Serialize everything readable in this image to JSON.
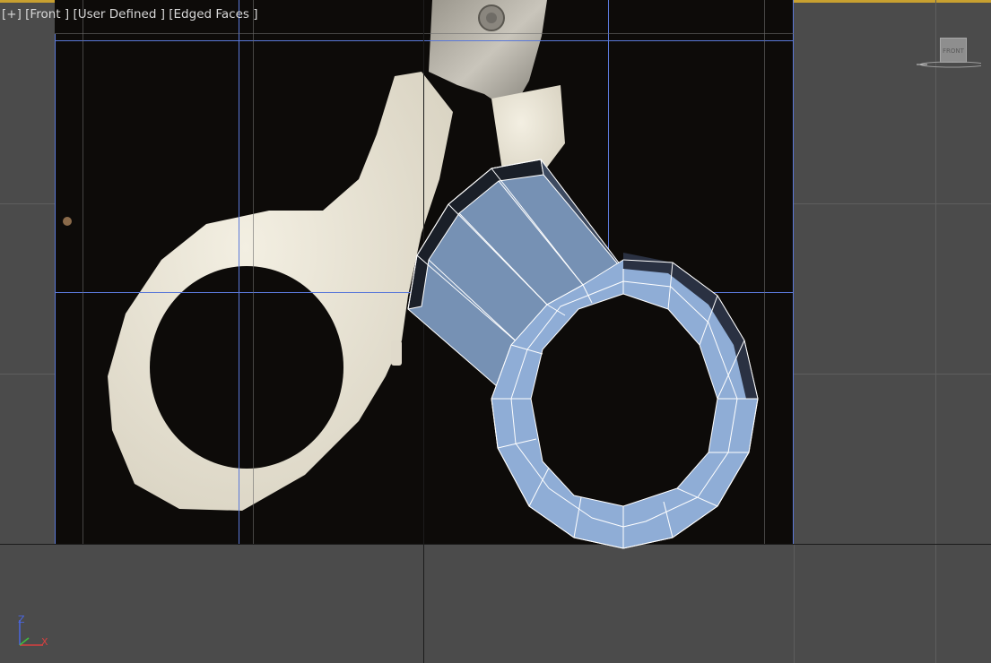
{
  "viewport": {
    "label_plus": "[+]",
    "label_view": "[Front ]",
    "label_shading": "[User Defined ]",
    "label_display": "[Edged Faces ]"
  },
  "viewcube": {
    "face_label": "FRONT"
  },
  "axis_gizmo": {
    "z_label": "Z",
    "x_label": "X"
  },
  "colors": {
    "viewport_bg": "#4b4b4b",
    "accent_border": "#c8a030",
    "mesh_face": "#7691b4",
    "mesh_edge": "#ffffff",
    "grid_blue": "#5a78d8",
    "scissor_handle": "#ece8da"
  }
}
